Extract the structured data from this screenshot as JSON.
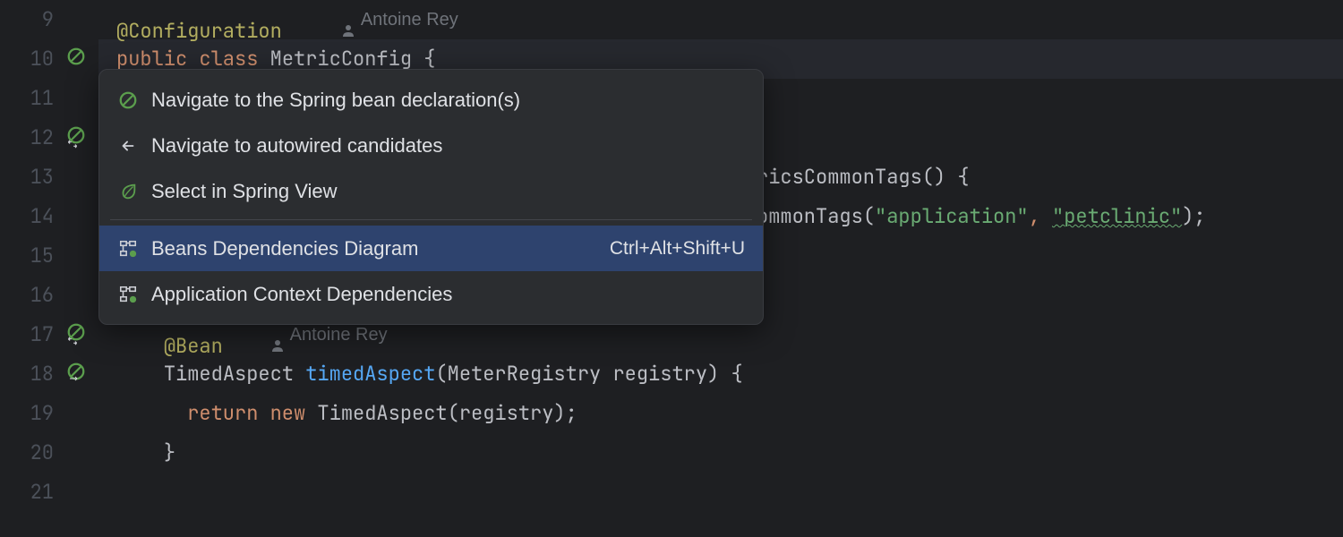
{
  "gutter": {
    "lines": [
      "9",
      "10",
      "11",
      "12",
      "13",
      "14",
      "15",
      "16",
      "17",
      "18",
      "19",
      "20",
      "21"
    ]
  },
  "code": {
    "line9": {
      "annotation": "@Configuration",
      "author": "Antoine Rey"
    },
    "line10": {
      "kw_public": "public",
      "kw_class": "class",
      "class_name": "MetricConfig",
      "brace_open": "{"
    },
    "line13": {
      "tail": "ricsCommonTags() {"
    },
    "line14": {
      "head": "ommonTags(",
      "arg1": "\"application\"",
      "comma": ",",
      "arg2": "\"petclinic\"",
      "tail": ");"
    },
    "line17": {
      "annotation": "@Bean",
      "author": "Antoine Rey"
    },
    "line18": {
      "type": "TimedAspect",
      "method": "timedAspect",
      "paren_open": "(",
      "param_type": "MeterRegistry",
      "param_name": "registry",
      "tail": ") {"
    },
    "line19": {
      "kw_return": "return",
      "kw_new": "new",
      "ctor": "TimedAspect(registry);"
    },
    "line20": {
      "brace": "}"
    }
  },
  "menu": {
    "item1": "Navigate to the Spring bean declaration(s)",
    "item2": "Navigate to autowired candidates",
    "item3": "Select in Spring View",
    "item4": "Beans Dependencies Diagram",
    "item4_shortcut": "Ctrl+Alt+Shift+U",
    "item5": "Application Context Dependencies"
  }
}
